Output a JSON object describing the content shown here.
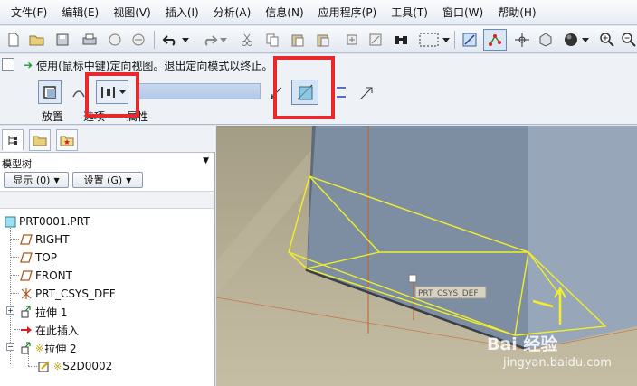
{
  "menubar": {
    "items": [
      "文件(F)",
      "编辑(E)",
      "视图(V)",
      "插入(I)",
      "分析(A)",
      "信息(N)",
      "应用程序(P)",
      "工具(T)",
      "窗口(W)",
      "帮助(H)"
    ]
  },
  "dashboard": {
    "message": "使用(鼠标中键)定向视图。退出定向模式以终止。",
    "depth_value": "",
    "tabs": {
      "placement": "放置",
      "options": "选项",
      "properties": "属性"
    }
  },
  "panel": {
    "title": "模型树",
    "show_button": "显示 (0)",
    "settings_button": "设置 (G)"
  },
  "tree": {
    "root": "PRT0001.PRT",
    "right": "RIGHT",
    "top": "TOP",
    "front": "FRONT",
    "csys": "PRT_CSYS_DEF",
    "extrude1": "拉伸 1",
    "insert_here": "在此插入",
    "extrude2": "拉伸 2",
    "sketch": "S2D0002"
  },
  "viewport": {
    "csys_label": "PRT_CSYS_DEF"
  },
  "watermark": {
    "brand": "Bai 经验",
    "url": "jingyan.baidu.com"
  },
  "colors": {
    "highlight_red": "#e8282c",
    "preview_yellow": "#f2ef2a",
    "model_surface": "#7f8fa2",
    "background": "#b4ab91"
  }
}
